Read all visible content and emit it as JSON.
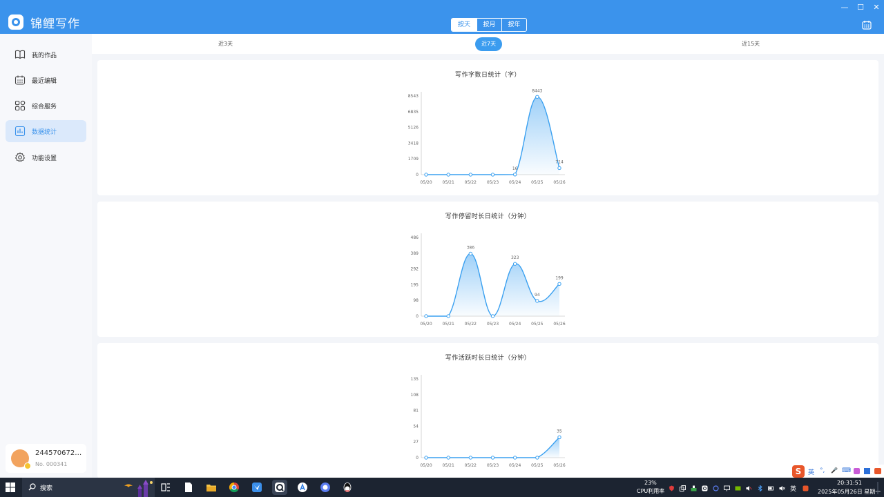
{
  "app": {
    "title": "锦鲤写作"
  },
  "header": {
    "segments": [
      "按天",
      "按月",
      "按年"
    ],
    "active_segment": 0,
    "window_controls": {
      "minimize": "—",
      "maximize": "☐",
      "close": "✕"
    }
  },
  "sidebar": {
    "items": [
      {
        "label": "我的作品",
        "icon": "book-icon"
      },
      {
        "label": "最近编辑",
        "icon": "calendar-icon"
      },
      {
        "label": "综合服务",
        "icon": "grid-icon"
      },
      {
        "label": "数据统计",
        "icon": "bar-chart-icon"
      },
      {
        "label": "功能设置",
        "icon": "gear-icon"
      }
    ],
    "active_index": 3,
    "user": {
      "name": "244570672…",
      "number": "No. 000341"
    }
  },
  "range_tabs": [
    "近3天",
    "近7天",
    "近15天"
  ],
  "active_range": 1,
  "colors": {
    "accent": "#3b93ec",
    "line": "#3aa0f0",
    "fill_top": "#8ec8f7"
  },
  "chart_data": [
    {
      "type": "area",
      "title": "写作字数日统计（字）",
      "categories": [
        "05/20",
        "05/21",
        "05/22",
        "05/23",
        "05/24",
        "05/25",
        "05/26"
      ],
      "values": [
        0,
        0,
        0,
        0,
        16,
        8443,
        714
      ],
      "data_labels": {
        "4": "16",
        "5": "8443",
        "6": "714"
      },
      "y_ticks": [
        "0",
        "1709",
        "3418",
        "5126",
        "6835",
        "8543"
      ],
      "ylim": [
        0,
        8543
      ],
      "smooth": true
    },
    {
      "type": "area",
      "title": "写作停留时长日统计（分钟）",
      "categories": [
        "05/20",
        "05/21",
        "05/22",
        "05/23",
        "05/24",
        "05/25",
        "05/26"
      ],
      "values": [
        0,
        0,
        386,
        0,
        323,
        94,
        199
      ],
      "data_labels": {
        "2": "386",
        "4": "323",
        "5": "94",
        "6": "199"
      },
      "y_ticks": [
        "0",
        "98",
        "195",
        "292",
        "389",
        "486"
      ],
      "ylim": [
        0,
        486
      ],
      "smooth": true
    },
    {
      "type": "area",
      "title": "写作活跃时长日统计（分钟）",
      "categories": [
        "05/20",
        "05/21",
        "05/22",
        "05/23",
        "05/24",
        "05/25",
        "05/26"
      ],
      "values": [
        0,
        0,
        0,
        0,
        0,
        0,
        35
      ],
      "data_labels": {
        "6": "35"
      },
      "y_ticks": [
        "0",
        "27",
        "54",
        "81",
        "108",
        "135"
      ],
      "ylim": [
        0,
        135
      ],
      "smooth": true
    }
  ],
  "taskbar": {
    "search_label": "搜索",
    "cpu_percent": "23%",
    "cpu_label": "CPU利用率",
    "ime_lang": "英",
    "time": "20:31:51",
    "date": "2025年05月26日 星期一",
    "ime_items": [
      "英",
      "°,",
      "🎤",
      "⌨"
    ]
  }
}
